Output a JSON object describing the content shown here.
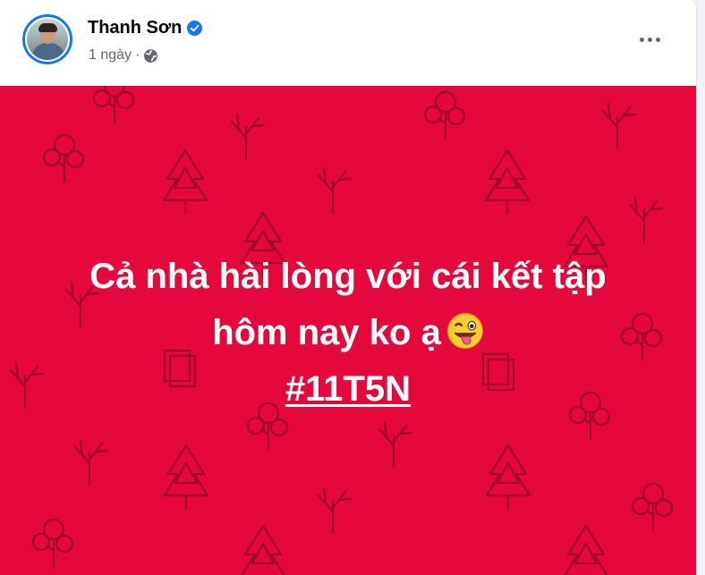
{
  "post": {
    "author": "Thanh Sơn",
    "verified_icon": "verified-badge-icon",
    "time": "1 ngày",
    "separator": "·",
    "privacy_icon": "globe-icon",
    "more_icon": "more-options-icon",
    "background_color": "#e5083d",
    "text_line1": "Cả nhà hài lòng với cái kết tập",
    "text_line2": "hôm nay ko ạ",
    "emoji_icon": "winking-face-with-tongue-icon",
    "hashtag": "#11T5N"
  },
  "colors": {
    "accent": "#1877f2",
    "secondary_text": "#65676b",
    "primary_text": "#050505"
  }
}
